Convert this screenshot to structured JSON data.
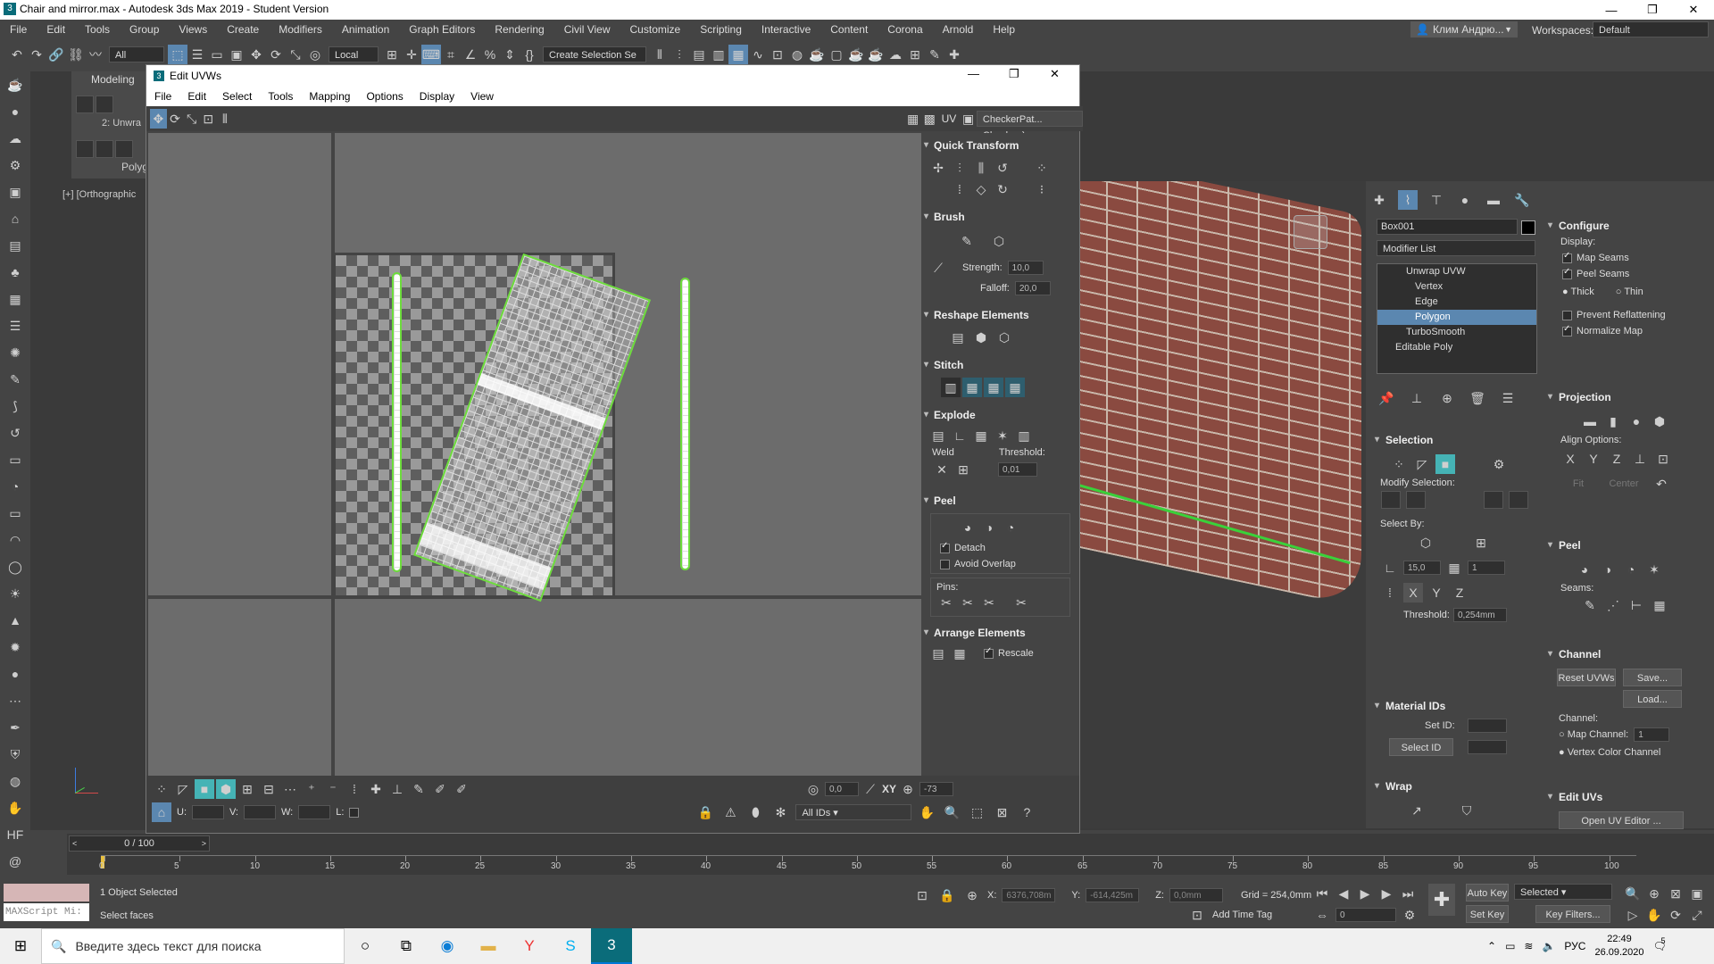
{
  "window": {
    "title": "Chair and mirror.max - Autodesk 3ds Max 2019 - Student Version",
    "min": "—",
    "max": "❐",
    "close": "✕"
  },
  "menu": [
    "File",
    "Edit",
    "Tools",
    "Group",
    "Views",
    "Create",
    "Modifiers",
    "Animation",
    "Graph Editors",
    "Rendering",
    "Civil View",
    "Customize",
    "Scripting",
    "Interactive",
    "Content",
    "Corona",
    "Arnold",
    "Help"
  ],
  "user": {
    "name": "Клим Андрю...",
    "workspaces_label": "Workspaces:",
    "workspace": "Default"
  },
  "toolbar": {
    "filter": "All",
    "coord": "Local",
    "selection_set": "Create Selection Se"
  },
  "ribbon": {
    "tab": "Modeling",
    "unwrap": "2: Unwra",
    "poly": "Polyg"
  },
  "viewport": {
    "label": "[+] [Orthographic"
  },
  "uvw": {
    "title": "Edit UVWs",
    "menu": [
      "File",
      "Edit",
      "Select",
      "Tools",
      "Mapping",
      "Options",
      "Display",
      "View"
    ],
    "uv_label": "UV",
    "texture": "CheckerPat... Checker )",
    "quick_transform": "Quick Transform",
    "brush": "Brush",
    "strength_label": "Strength:",
    "strength": "10,0",
    "falloff_label": "Falloff:",
    "falloff": "20,0",
    "reshape": "Reshape Elements",
    "stitch": "Stitch",
    "explode": "Explode",
    "weld": "Weld",
    "threshold_label": "Threshold:",
    "threshold": "0,01",
    "peel": "Peel",
    "detach": "Detach",
    "avoid_overlap": "Avoid Overlap",
    "pins": "Pins:",
    "arrange": "Arrange Elements",
    "rescale": "Rescale",
    "u_label": "U:",
    "v_label": "V:",
    "w_label": "W:",
    "l_label": "L:",
    "rot_value": "0,0",
    "xy": "XY",
    "angle": "-73",
    "ids": "All IDs"
  },
  "cmd": {
    "object_name": "Box001",
    "modifier_list": "Modifier List",
    "stack": [
      "Unwrap UVW",
      "Vertex",
      "Edge",
      "Polygon",
      "TurboSmooth",
      "Editable Poly"
    ],
    "selection": "Selection",
    "modify_selection": "Modify Selection:",
    "select_by": "Select By:",
    "angle_value": "15,0",
    "count_value": "1",
    "threshold_label": "Threshold:",
    "threshold": "0,254mm",
    "material_ids": "Material IDs",
    "set_id": "Set ID:",
    "select_id": "Select ID",
    "wrap": "Wrap",
    "configure": "Configure",
    "display": "Display:",
    "map_seams": "Map Seams",
    "peel_seams": "Peel Seams",
    "thick": "Thick",
    "thin": "Thin",
    "prevent_reflattening": "Prevent Reflattening",
    "normalize_map": "Normalize Map",
    "projection": "Projection",
    "align_options": "Align Options:",
    "fit": "Fit",
    "center": "Center",
    "peel": "Peel",
    "seams": "Seams:",
    "channel": "Channel",
    "reset_uvws": "Reset UVWs",
    "save": "Save...",
    "load": "Load...",
    "channel_label": "Channel:",
    "map_channel": "Map Channel:",
    "map_channel_value": "1",
    "vertex_color_channel": "Vertex Color Channel",
    "edit_uvs": "Edit UVs",
    "open_uv_editor": "Open UV Editor ..."
  },
  "timeline": {
    "frame": "0 / 100",
    "ticks": [
      "0",
      "5",
      "10",
      "15",
      "20",
      "25",
      "30",
      "35",
      "40",
      "45",
      "50",
      "55",
      "60",
      "65",
      "70",
      "75",
      "80",
      "85",
      "90",
      "95",
      "100"
    ]
  },
  "status": {
    "maxscript": "MAXScript Mi:",
    "selected": "1 Object Selected",
    "prompt": "Select faces",
    "x_label": "X:",
    "x": "6376,708m",
    "y_label": "Y:",
    "y": "-614,425m",
    "z_label": "Z:",
    "z": "0,0mm",
    "grid": "Grid = 254,0mm",
    "add_time_tag": "Add Time Tag",
    "auto_key": "Auto Key",
    "set_key": "Set Key",
    "key_mode": "Selected",
    "key_filters": "Key Filters...",
    "frame_field": "0"
  },
  "taskbar": {
    "search": "Введите здесь текст для поиска",
    "lang": "РУС",
    "time": "22:49",
    "date": "26.09.2020",
    "notif": "5"
  }
}
